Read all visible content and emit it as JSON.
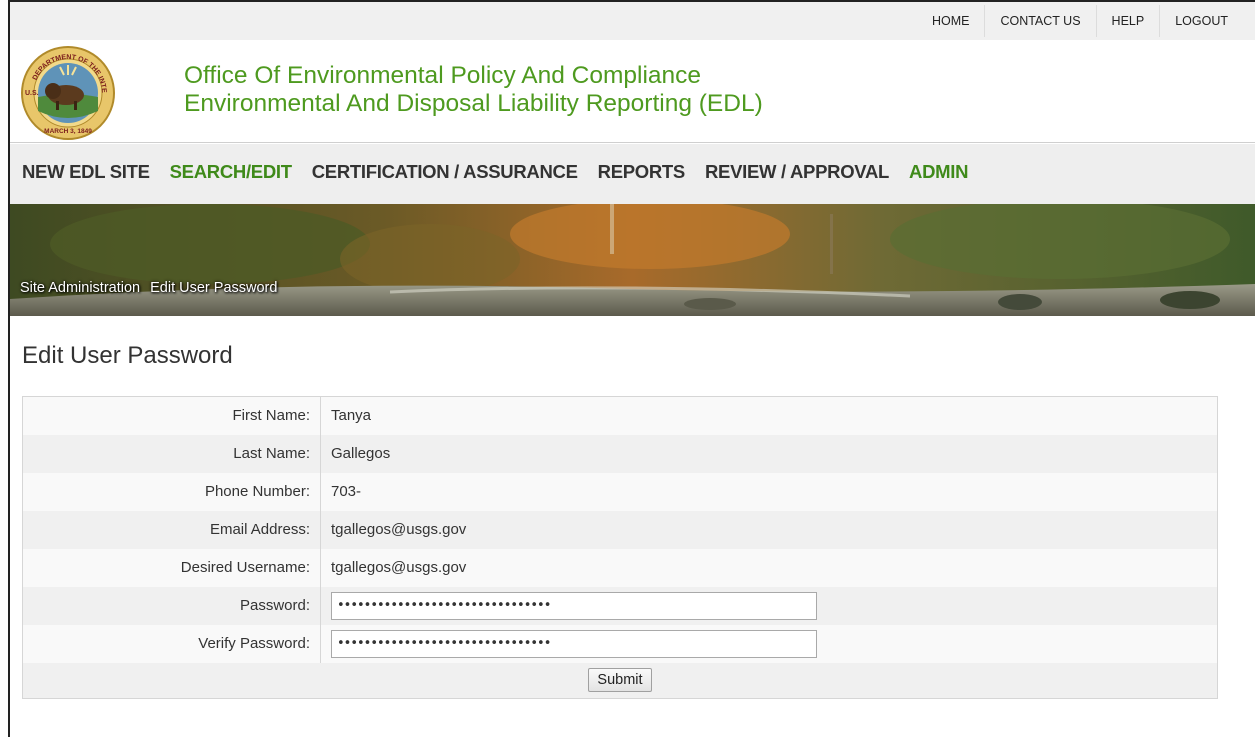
{
  "topnav": {
    "home": "HOME",
    "contact": "CONTACT US",
    "help": "HELP",
    "logout": "LOGOUT"
  },
  "header": {
    "title_line1": "Office Of Environmental Policy And Compliance",
    "title_line2": "Environmental And Disposal Liability Reporting (EDL)",
    "seal_top_text": "DEPARTMENT OF THE INTERIOR",
    "seal_left_text": "U.S.",
    "seal_bottom_text": "MARCH 3, 1849",
    "brand_color": "#4e9a1f"
  },
  "mainnav": {
    "items": [
      {
        "label": "NEW EDL SITE"
      },
      {
        "label": "SEARCH/EDIT"
      },
      {
        "label": "CERTIFICATION / ASSURANCE"
      },
      {
        "label": "REPORTS"
      },
      {
        "label": "REVIEW / APPROVAL"
      },
      {
        "label": "ADMIN"
      }
    ]
  },
  "breadcrumb": {
    "part1": "Site Administration",
    "part2": "Edit User Password"
  },
  "page": {
    "title": "Edit User Password"
  },
  "form": {
    "first_name_label": "First Name:",
    "first_name_value": "Tanya",
    "last_name_label": "Last Name:",
    "last_name_value": "Gallegos",
    "phone_label": "Phone Number:",
    "phone_value": "703-",
    "email_label": "Email Address:",
    "email_value": "tgallegos@usgs.gov",
    "username_label": "Desired Username:",
    "username_value": "tgallegos@usgs.gov",
    "password_label": "Password:",
    "password_value": "••••••••••••••••••••••••••••••••",
    "verify_label": "Verify Password:",
    "verify_value": "••••••••••••••••••••••••••••••••",
    "submit_label": "Submit"
  }
}
